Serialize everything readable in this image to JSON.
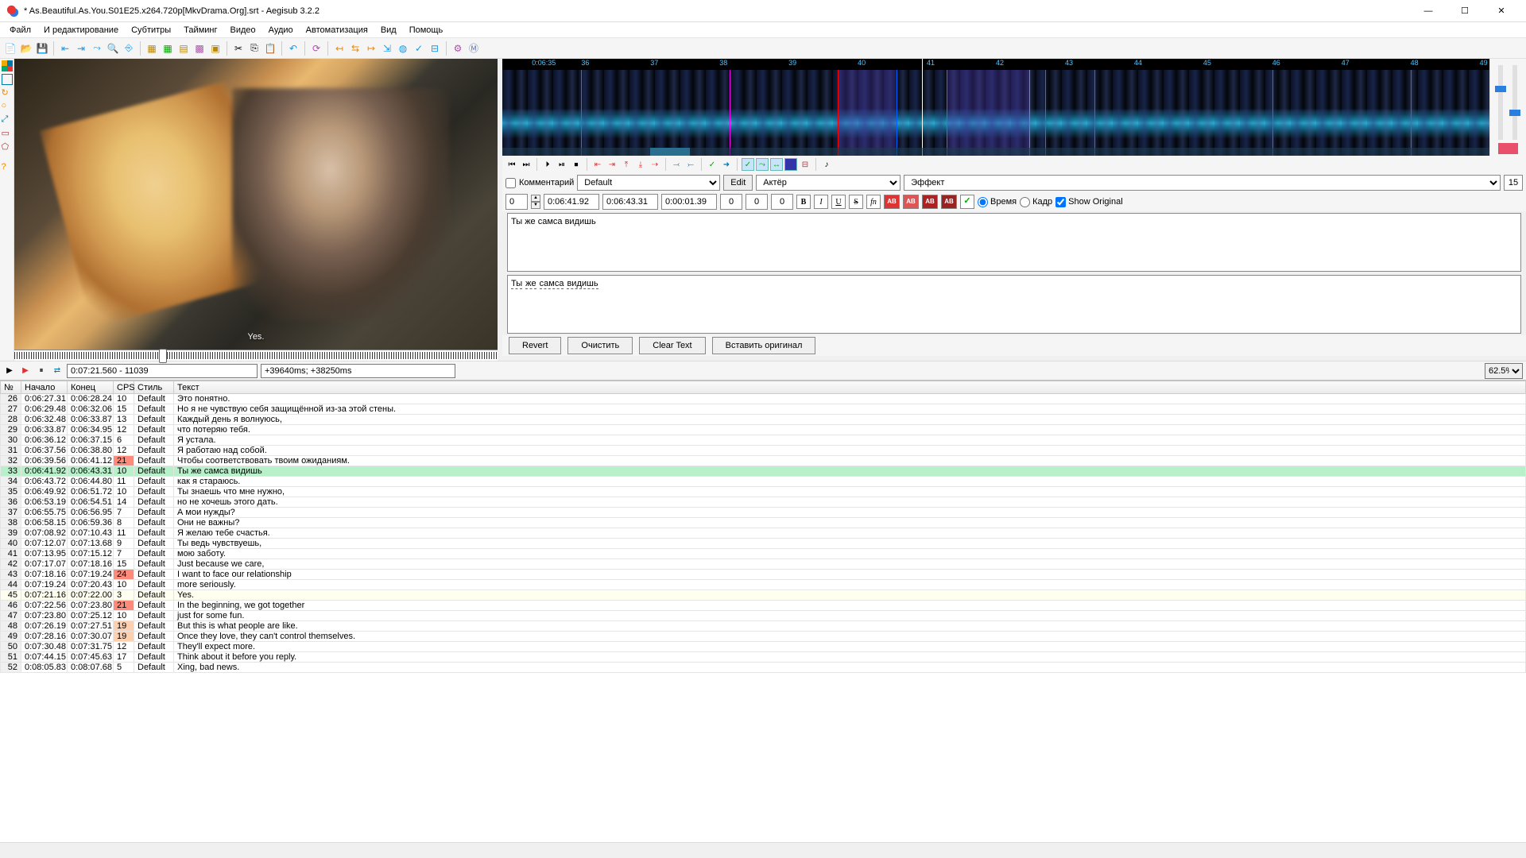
{
  "title": "* As.Beautiful.As.You.S01E25.x264.720p[MkvDrama.Org].srt - Aegisub 3.2.2",
  "menu": [
    "Файл",
    "И редактирование",
    "Субтитры",
    "Тайминг",
    "Видео",
    "Аудио",
    "Автоматизация",
    "Вид",
    "Помощь"
  ],
  "video": {
    "subtitle": "Yes.",
    "tcpos": "0:07:21.560 - 11039",
    "offset": "+39640ms; +38250ms",
    "zoom": "62.5%"
  },
  "audio_ticks": [
    {
      "t": "0:06:35",
      "p": 3
    },
    {
      "t": "36",
      "p": 8
    },
    {
      "t": "37",
      "p": 15
    },
    {
      "t": "38",
      "p": 22
    },
    {
      "t": "39",
      "p": 29
    },
    {
      "t": "40",
      "p": 36
    },
    {
      "t": "41",
      "p": 43
    },
    {
      "t": "42",
      "p": 50
    },
    {
      "t": "43",
      "p": 57
    },
    {
      "t": "44",
      "p": 64
    },
    {
      "t": "45",
      "p": 71
    },
    {
      "t": "46",
      "p": 78
    },
    {
      "t": "47",
      "p": 85
    },
    {
      "t": "48",
      "p": 92
    },
    {
      "t": "49",
      "p": 99
    }
  ],
  "edit": {
    "comment_label": "Комментарий",
    "style": "Default",
    "edit_btn": "Edit",
    "actor_ph": "Актёр",
    "effect_ph": "Эффект",
    "chars": "15",
    "layer": "0",
    "start": "0:06:41.92",
    "end": "0:06:43.31",
    "dur": "0:00:01.39",
    "ml": "0",
    "mr": "0",
    "mv": "0",
    "time_label": "Время",
    "frame_label": "Кадр",
    "show_orig": "Show Original",
    "text": "Ты же самса видишь",
    "text_words": [
      "Ты",
      "же",
      "самса",
      "видишь"
    ],
    "revert": "Revert",
    "clear1": "Очистить",
    "clear2": "Clear Text",
    "paste": "Вставить оригинал"
  },
  "headers": {
    "n": "№",
    "start": "Начало",
    "end": "Конец",
    "cps": "CPS",
    "style": "Стиль",
    "text": "Текст"
  },
  "rows": [
    {
      "n": 26,
      "s": "0:06:27.31",
      "e": "0:06:28.24",
      "c": "10",
      "st": "Default",
      "t": "Это понятно."
    },
    {
      "n": 27,
      "s": "0:06:29.48",
      "e": "0:06:32.06",
      "c": "15",
      "st": "Default",
      "t": "Но я не чувствую себя защищённой из-за этой стены."
    },
    {
      "n": 28,
      "s": "0:06:32.48",
      "e": "0:06:33.87",
      "c": "13",
      "st": "Default",
      "t": "Каждый день я волнуюсь,"
    },
    {
      "n": 29,
      "s": "0:06:33.87",
      "e": "0:06:34.95",
      "c": "12",
      "st": "Default",
      "t": "что потеряю тебя."
    },
    {
      "n": 30,
      "s": "0:06:36.12",
      "e": "0:06:37.15",
      "c": "6",
      "st": "Default",
      "t": "Я устала."
    },
    {
      "n": 31,
      "s": "0:06:37.56",
      "e": "0:06:38.80",
      "c": "12",
      "st": "Default",
      "t": "Я работаю над собой."
    },
    {
      "n": 32,
      "s": "0:06:39.56",
      "e": "0:06:41.12",
      "c": "21",
      "st": "Default",
      "t": "Чтобы соответствовать твоим ожиданиям.",
      "hot": true
    },
    {
      "n": 33,
      "s": "0:06:41.92",
      "e": "0:06:43.31",
      "c": "10",
      "st": "Default",
      "t": "Ты же самса видишь",
      "sel": true
    },
    {
      "n": 34,
      "s": "0:06:43.72",
      "e": "0:06:44.80",
      "c": "11",
      "st": "Default",
      "t": "как я стараюсь."
    },
    {
      "n": 35,
      "s": "0:06:49.92",
      "e": "0:06:51.72",
      "c": "10",
      "st": "Default",
      "t": "Ты знаешь что мне нужно,"
    },
    {
      "n": 36,
      "s": "0:06:53.19",
      "e": "0:06:54.51",
      "c": "14",
      "st": "Default",
      "t": "но не хочешь этого дать."
    },
    {
      "n": 37,
      "s": "0:06:55.75",
      "e": "0:06:56.95",
      "c": "7",
      "st": "Default",
      "t": "А мои нужды?"
    },
    {
      "n": 38,
      "s": "0:06:58.15",
      "e": "0:06:59.36",
      "c": "8",
      "st": "Default",
      "t": "Они не важны?"
    },
    {
      "n": 39,
      "s": "0:07:08.92",
      "e": "0:07:10.43",
      "c": "11",
      "st": "Default",
      "t": "Я желаю тебе счастья."
    },
    {
      "n": 40,
      "s": "0:07:12.07",
      "e": "0:07:13.68",
      "c": "9",
      "st": "Default",
      "t": "Ты ведь чувствуешь,"
    },
    {
      "n": 41,
      "s": "0:07:13.95",
      "e": "0:07:15.12",
      "c": "7",
      "st": "Default",
      "t": "мою заботу."
    },
    {
      "n": 42,
      "s": "0:07:17.07",
      "e": "0:07:18.16",
      "c": "15",
      "st": "Default",
      "t": "Just because we care,"
    },
    {
      "n": 43,
      "s": "0:07:18.16",
      "e": "0:07:19.24",
      "c": "24",
      "st": "Default",
      "t": "I want to face our relationship",
      "hot": true
    },
    {
      "n": 44,
      "s": "0:07:19.24",
      "e": "0:07:20.43",
      "c": "10",
      "st": "Default",
      "t": "more seriously."
    },
    {
      "n": 45,
      "s": "0:07:21.16",
      "e": "0:07:22.00",
      "c": "3",
      "st": "Default",
      "t": "Yes.",
      "cmt": true
    },
    {
      "n": 46,
      "s": "0:07:22.56",
      "e": "0:07:23.80",
      "c": "21",
      "st": "Default",
      "t": "In the beginning, we got together",
      "hot": true
    },
    {
      "n": 47,
      "s": "0:07:23.80",
      "e": "0:07:25.12",
      "c": "10",
      "st": "Default",
      "t": "just for some fun."
    },
    {
      "n": 48,
      "s": "0:07:26.19",
      "e": "0:07:27.51",
      "c": "19",
      "st": "Default",
      "t": "But this is what people are like.",
      "warm": true
    },
    {
      "n": 49,
      "s": "0:07:28.16",
      "e": "0:07:30.07",
      "c": "19",
      "st": "Default",
      "t": "Once they love, they can't control themselves.",
      "warm": true
    },
    {
      "n": 50,
      "s": "0:07:30.48",
      "e": "0:07:31.75",
      "c": "12",
      "st": "Default",
      "t": "They'll expect more."
    },
    {
      "n": 51,
      "s": "0:07:44.15",
      "e": "0:07:45.63",
      "c": "17",
      "st": "Default",
      "t": "Think about it before you reply."
    },
    {
      "n": 52,
      "s": "0:08:05.83",
      "e": "0:08:07.68",
      "c": "5",
      "st": "Default",
      "t": "Xing, bad news."
    }
  ]
}
